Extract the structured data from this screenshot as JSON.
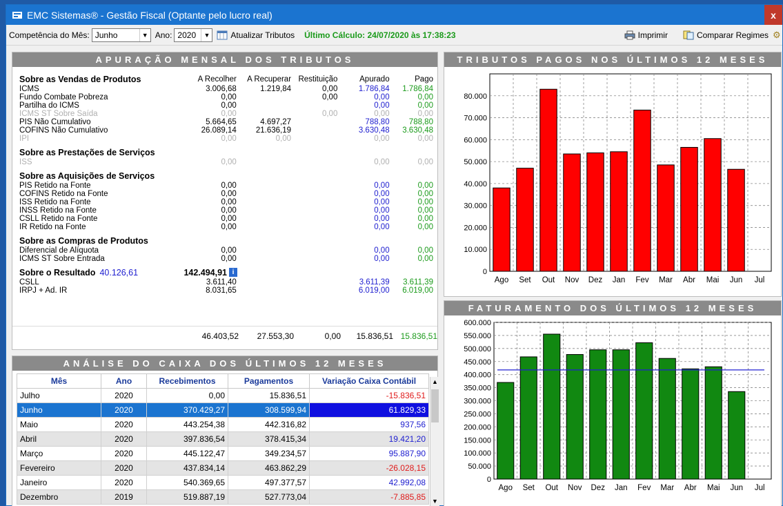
{
  "window": {
    "title": "EMC Sistemas® - Gestão Fiscal (Optante pelo lucro real)",
    "close": "x"
  },
  "toolbar": {
    "competencia_label": "Competência do Mês:",
    "competencia_value": "Junho",
    "ano_label": "Ano:",
    "ano_value": "2020",
    "atualizar": "Atualizar Tributos",
    "ultimo_calculo": "Último Cálculo: 24/07/2020 às 17:38:23",
    "imprimir": "Imprimir",
    "comparar": "Comparar Regimes"
  },
  "apuracao": {
    "title": "APURAÇÃO MENSAL DOS TRIBUTOS",
    "columns": [
      "A Recolher",
      "A Recuperar",
      "Restituição",
      "Apurado",
      "Pago"
    ],
    "sections": [
      {
        "title": "Sobre as Vendas de Produtos",
        "rows": [
          {
            "label": "ICMS",
            "recolher": "3.006,68",
            "recuperar": "1.219,84",
            "restituicao": "0,00",
            "apurado": "1.786,84",
            "pago": "1.786,84"
          },
          {
            "label": "Fundo Combate Pobreza",
            "recolher": "0,00",
            "recuperar": "",
            "restituicao": "0,00",
            "apurado": "0,00",
            "pago": "0,00"
          },
          {
            "label": "Partilha do ICMS",
            "recolher": "0,00",
            "recuperar": "",
            "restituicao": "",
            "apurado": "0,00",
            "pago": "0,00"
          },
          {
            "label": "ICMS ST Sobre Saída",
            "recolher": "0,00",
            "recuperar": "",
            "restituicao": "0,00",
            "apurado": "0,00",
            "pago": "0,00",
            "disabled": true
          },
          {
            "label": "PIS Não Cumulativo",
            "recolher": "5.664,65",
            "recuperar": "4.697,27",
            "restituicao": "",
            "apurado": "788,80",
            "pago": "788,80"
          },
          {
            "label": "COFINS Não Cumulativo",
            "recolher": "26.089,14",
            "recuperar": "21.636,19",
            "restituicao": "",
            "apurado": "3.630,48",
            "pago": "3.630,48"
          },
          {
            "label": "IPI",
            "recolher": "0,00",
            "recuperar": "0,00",
            "restituicao": "",
            "apurado": "0,00",
            "pago": "0,00",
            "disabled": true
          }
        ]
      },
      {
        "title": "Sobre as Prestações de Serviços",
        "rows": [
          {
            "label": "ISS",
            "recolher": "0,00",
            "recuperar": "",
            "restituicao": "",
            "apurado": "0,00",
            "pago": "0,00",
            "disabled": true
          }
        ]
      },
      {
        "title": "Sobre as Aquisições de Serviços",
        "rows": [
          {
            "label": "PIS Retido na Fonte",
            "recolher": "0,00",
            "recuperar": "",
            "restituicao": "",
            "apurado": "0,00",
            "pago": "0,00"
          },
          {
            "label": "COFINS Retido na Fonte",
            "recolher": "0,00",
            "recuperar": "",
            "restituicao": "",
            "apurado": "0,00",
            "pago": "0,00"
          },
          {
            "label": "ISS Retido na Fonte",
            "recolher": "0,00",
            "recuperar": "",
            "restituicao": "",
            "apurado": "0,00",
            "pago": "0,00"
          },
          {
            "label": "INSS Retido na Fonte",
            "recolher": "0,00",
            "recuperar": "",
            "restituicao": "",
            "apurado": "0,00",
            "pago": "0,00"
          },
          {
            "label": "CSLL Retido na Fonte",
            "recolher": "0,00",
            "recuperar": "",
            "restituicao": "",
            "apurado": "0,00",
            "pago": "0,00"
          },
          {
            "label": "IR Retido na Fonte",
            "recolher": "0,00",
            "recuperar": "",
            "restituicao": "",
            "apurado": "0,00",
            "pago": "0,00"
          }
        ]
      },
      {
        "title": "Sobre as Compras de Produtos",
        "rows": [
          {
            "label": "Diferencial de Alíquota",
            "recolher": "0,00",
            "recuperar": "",
            "restituicao": "",
            "apurado": "0,00",
            "pago": "0,00"
          },
          {
            "label": "ICMS ST Sobre Entrada",
            "recolher": "0,00",
            "recuperar": "",
            "restituicao": "",
            "apurado": "0,00",
            "pago": "0,00"
          }
        ]
      },
      {
        "title": "Sobre o Resultado",
        "title_value": "40.126,61",
        "title_value2": "142.494,91",
        "rows": [
          {
            "label": "CSLL",
            "recolher": "3.611,40",
            "recuperar": "",
            "restituicao": "",
            "apurado": "3.611,39",
            "pago": "3.611,39"
          },
          {
            "label": "IRPJ + Ad. IR",
            "recolher": "8.031,65",
            "recuperar": "",
            "restituicao": "",
            "apurado": "6.019,00",
            "pago": "6.019,00"
          }
        ]
      }
    ],
    "totals": {
      "recolher": "46.403,52",
      "recuperar": "27.553,30",
      "restituicao": "0,00",
      "apurado": "15.836,51",
      "pago": "15.836,51"
    }
  },
  "caixa": {
    "title": "ANÁLISE DO CAIXA DOS ÚLTIMOS 12 MESES",
    "columns": [
      "Mês",
      "Ano",
      "Recebimentos",
      "Pagamentos",
      "Variação Caixa Contábil"
    ],
    "rows": [
      {
        "mes": "Julho",
        "ano": "2020",
        "rec": "0,00",
        "pag": "15.836,51",
        "var": "-15.836,51",
        "neg": true
      },
      {
        "mes": "Junho",
        "ano": "2020",
        "rec": "370.429,27",
        "pag": "308.599,94",
        "var": "61.829,33",
        "neg": false,
        "selected": true
      },
      {
        "mes": "Maio",
        "ano": "2020",
        "rec": "443.254,38",
        "pag": "442.316,82",
        "var": "937,56",
        "neg": false
      },
      {
        "mes": "Abril",
        "ano": "2020",
        "rec": "397.836,54",
        "pag": "378.415,34",
        "var": "19.421,20",
        "neg": false
      },
      {
        "mes": "Março",
        "ano": "2020",
        "rec": "445.122,47",
        "pag": "349.234,57",
        "var": "95.887,90",
        "neg": false
      },
      {
        "mes": "Fevereiro",
        "ano": "2020",
        "rec": "437.834,14",
        "pag": "463.862,29",
        "var": "-26.028,15",
        "neg": true
      },
      {
        "mes": "Janeiro",
        "ano": "2020",
        "rec": "540.369,65",
        "pag": "497.377,57",
        "var": "42.992,08",
        "neg": false
      },
      {
        "mes": "Dezembro",
        "ano": "2019",
        "rec": "519.887,19",
        "pag": "527.773,04",
        "var": "-7.885,85",
        "neg": true
      }
    ]
  },
  "chart_data": [
    {
      "type": "bar",
      "title": "TRIBUTOS PAGOS NOS ÚLTIMOS 12 MESES",
      "categories": [
        "Ago",
        "Set",
        "Out",
        "Nov",
        "Dez",
        "Jan",
        "Fev",
        "Mar",
        "Abr",
        "Mai",
        "Jun",
        "Jul"
      ],
      "values": [
        38000,
        47000,
        83000,
        53500,
        54000,
        54500,
        73500,
        48500,
        56500,
        60500,
        46500,
        0
      ],
      "yticks": [
        "0",
        "10.000",
        "20.000",
        "30.000",
        "40.000",
        "50.000",
        "60.000",
        "70.000",
        "80.000"
      ],
      "ylim": [
        0,
        90000
      ],
      "ytick_step": 10000,
      "color": "#ff0000",
      "grid": true
    },
    {
      "type": "bar",
      "title": "FATURAMENTO DOS ÚLTIMOS 12 MESES",
      "categories": [
        "Ago",
        "Set",
        "Out",
        "Nov",
        "Dez",
        "Jan",
        "Fev",
        "Mar",
        "Abr",
        "Mai",
        "Jun",
        "Jul"
      ],
      "values": [
        370000,
        468000,
        555000,
        477000,
        495000,
        495000,
        522000,
        462000,
        422000,
        430000,
        335000,
        0
      ],
      "average": 418000,
      "yticks": [
        "0",
        "50.000",
        "100.000",
        "150.000",
        "200.000",
        "250.000",
        "300.000",
        "350.000",
        "400.000",
        "450.000",
        "500.000",
        "550.000",
        "600.000"
      ],
      "ylim": [
        0,
        600000
      ],
      "ytick_step": 50000,
      "color": "#118811",
      "line_color": "#2020d0",
      "grid": true
    }
  ]
}
